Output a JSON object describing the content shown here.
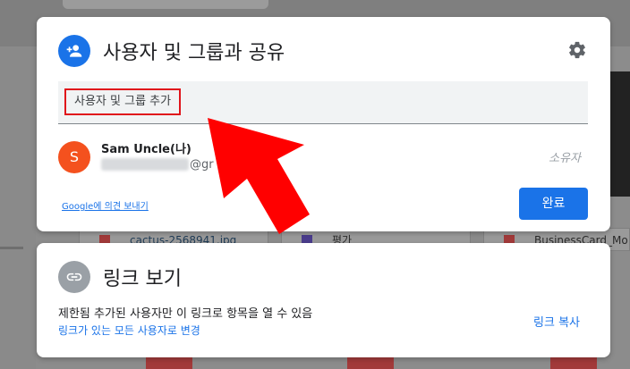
{
  "background": {
    "files": [
      {
        "name": "cactus-2568941.jpg"
      },
      {
        "name": "평가"
      },
      {
        "name": "BusinessCard_Mo"
      }
    ]
  },
  "share_dialog": {
    "title": "사용자 및 그룹과 공유",
    "settings_icon": "gear-icon",
    "add_people_placeholder": "사용자 및 그룹 추가",
    "member": {
      "avatar_letter": "S",
      "name": "Sam Uncle(나)",
      "email_visible": "@gr",
      "role": "소유자"
    },
    "feedback_link": "Google에 의견 보내기",
    "done_button": "완료"
  },
  "link_panel": {
    "title": "링크 보기",
    "description": "제한됨 추가된 사용자만 이 링크로 항목을 열 수 있음",
    "change_link": "링크가 있는 모든 사용자로 변경",
    "copy_link": "링크 복사"
  },
  "colors": {
    "accent": "#1a73e8",
    "avatar": "#f4511e",
    "highlight": "#e0141b"
  }
}
